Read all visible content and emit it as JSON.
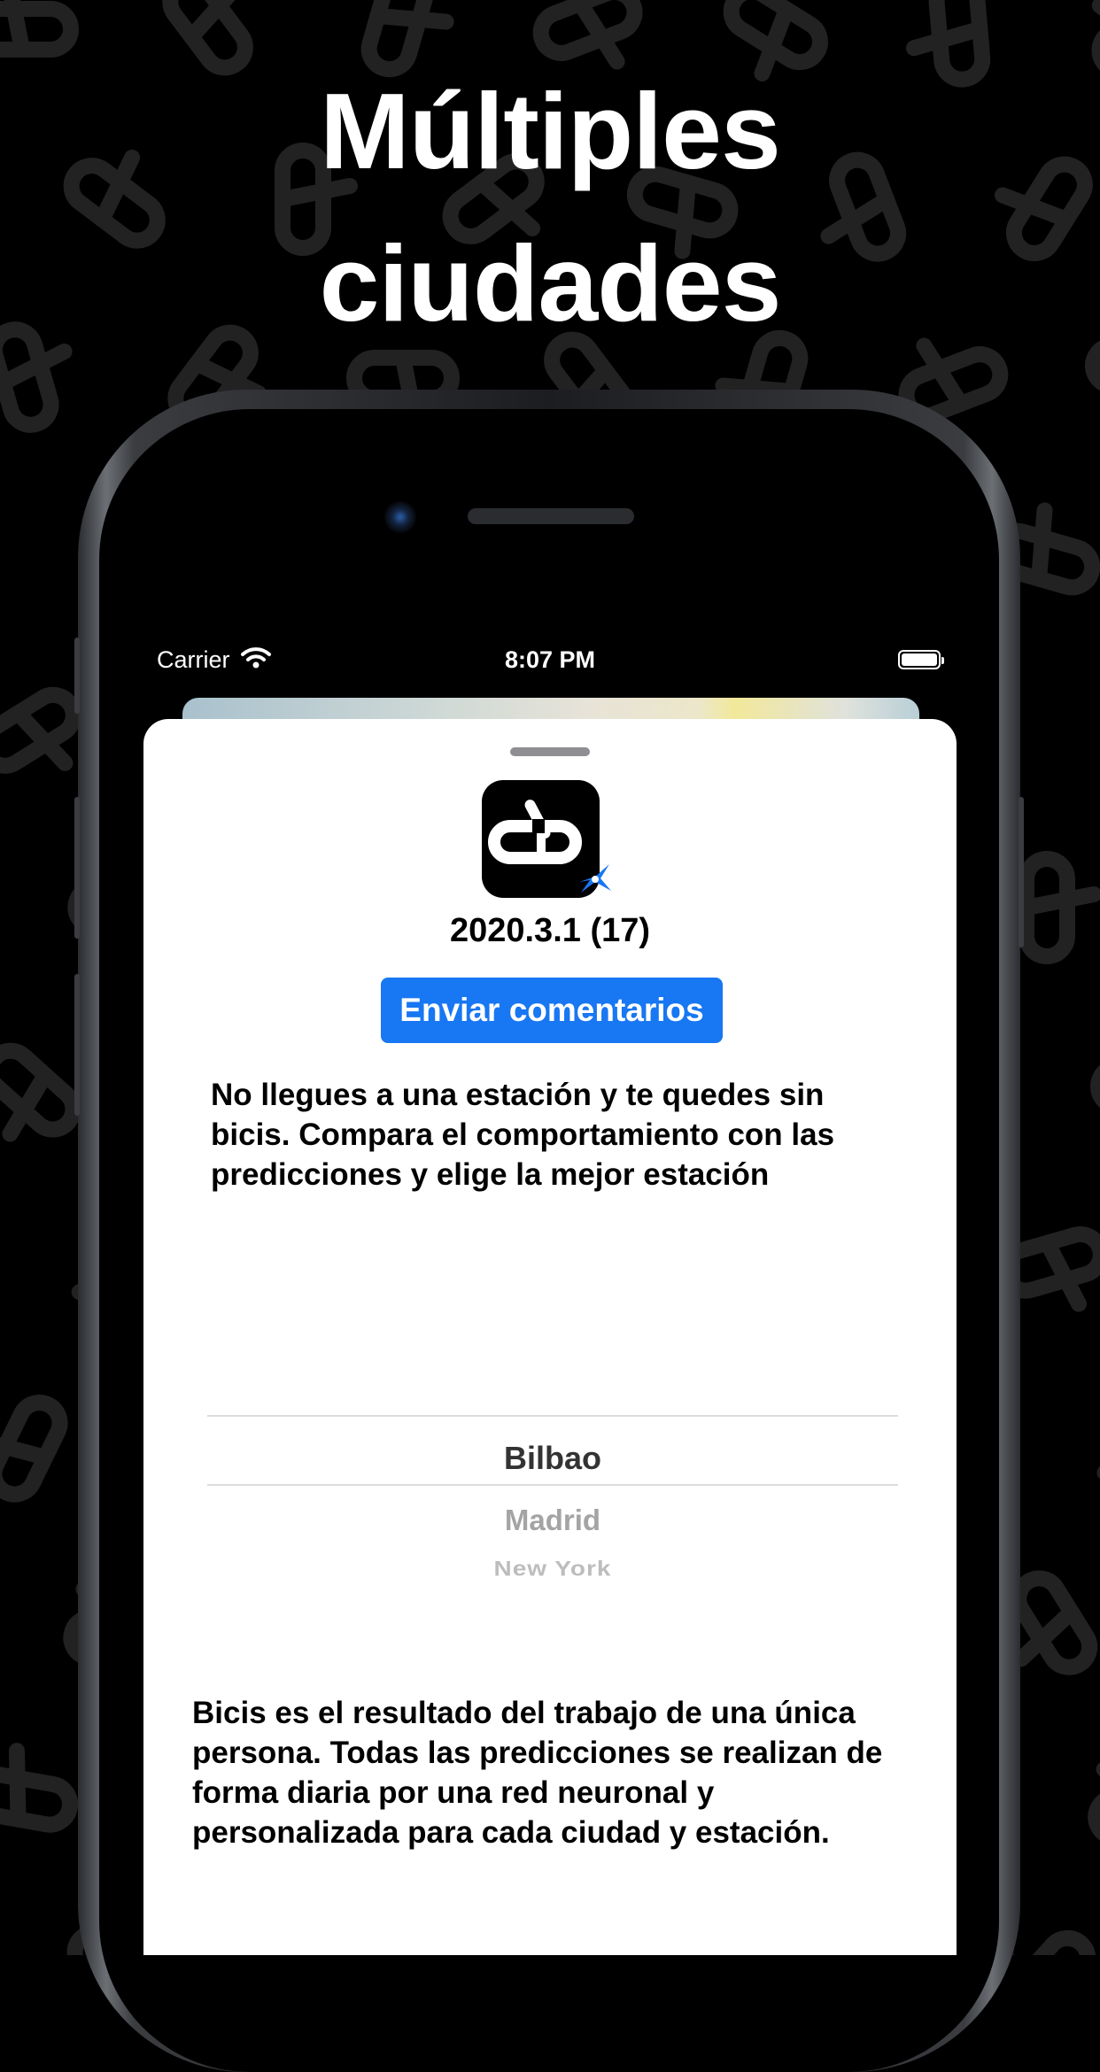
{
  "headline": {
    "line1": "Múltiples",
    "line2": "ciudades"
  },
  "status_bar": {
    "carrier": "Carrier",
    "time": "8:07 PM"
  },
  "sheet": {
    "app_icon": "bicis-logo-icon",
    "beta_badge_icon": "testflight-propeller-icon",
    "version": "2020.3.1 (17)",
    "feedback_button": "Enviar comentarios",
    "description": "No llegues a una estación y te quedes sin bicis. Compara el comportamiento con las predicciones y elige la mejor estación",
    "city_picker": {
      "selected": "Bilbao",
      "options": [
        "Bilbao",
        "Madrid",
        "New York"
      ]
    },
    "about": "Bicis es el resultado del trabajo de una única persona. Todas las predicciones se realizan de forma diaria por una red neuronal y personalizada para cada ciudad y estación."
  },
  "colors": {
    "background": "#000000",
    "accent": "#1877f2",
    "sheet": "#ffffff"
  }
}
